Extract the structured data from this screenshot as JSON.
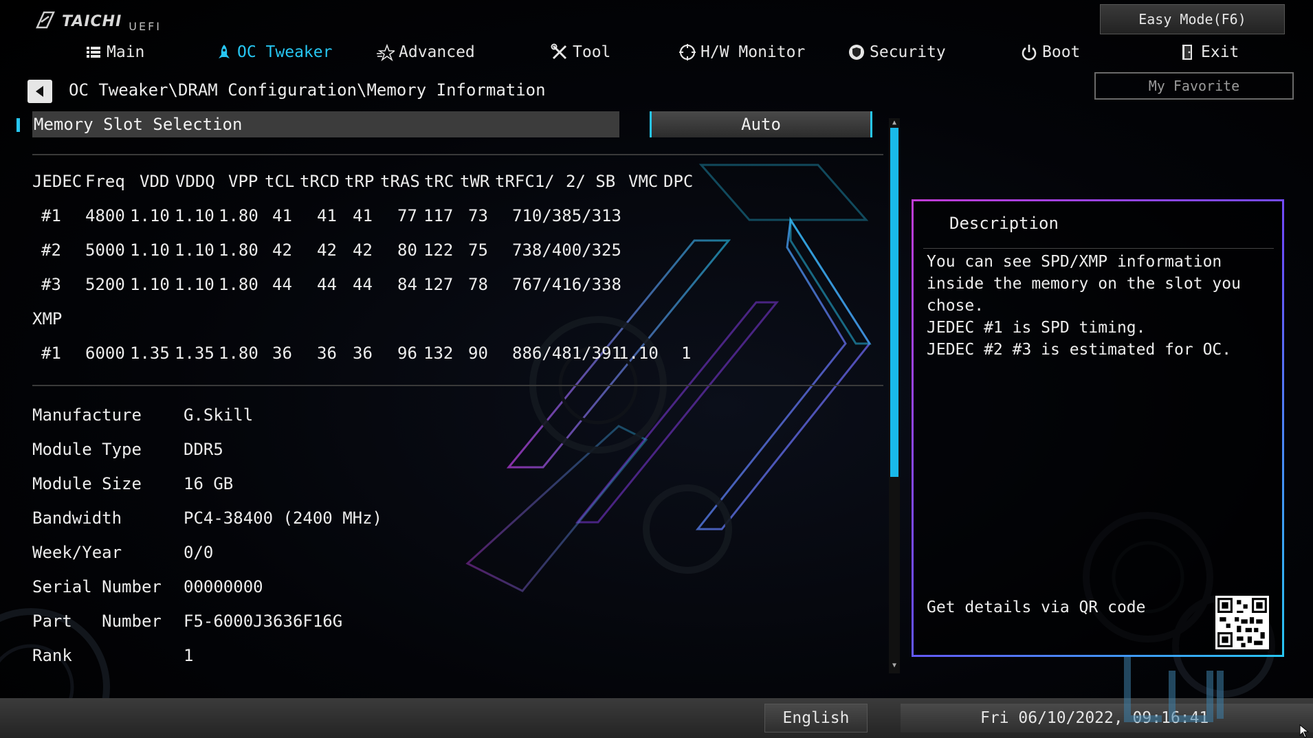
{
  "app": {
    "logo_text": "TAICHI",
    "logo_sub": "UEFI"
  },
  "nav": [
    {
      "label": "Main",
      "icon": "list-icon"
    },
    {
      "label": "OC Tweaker",
      "icon": "rocket-icon",
      "active": true
    },
    {
      "label": "Advanced",
      "icon": "star-icon"
    },
    {
      "label": "Tool",
      "icon": "tools-icon"
    },
    {
      "label": "H/W Monitor",
      "icon": "monitor-icon"
    },
    {
      "label": "Security",
      "icon": "shield-icon"
    },
    {
      "label": "Boot",
      "icon": "power-icon"
    },
    {
      "label": "Exit",
      "icon": "exit-door-icon"
    }
  ],
  "easy_mode_label": "Easy Mode(F6)",
  "my_favorite_label": "My Favorite",
  "breadcrumb": "OC Tweaker\\DRAM Configuration\\Memory Information",
  "slot_selection": {
    "label": "Memory Slot Selection",
    "value": "Auto"
  },
  "spd_table": {
    "headers": [
      "JEDEC",
      "Freq",
      "VDD",
      "VDDQ",
      "VPP",
      "tCL",
      "tRCD",
      "tRP",
      "tRAS",
      "tRC",
      "tWR",
      "tRFC1/",
      "2/ SB",
      "VMC",
      "DPC"
    ],
    "jedec_rows": [
      {
        "id": "#1",
        "freq": "4800",
        "vdd": "1.10",
        "vddq": "1.10",
        "vpp": "1.80",
        "tcl": "41",
        "trcd": "41",
        "trp": "41",
        "tras": "77",
        "trc": "117",
        "twr": "73",
        "trfc": "710/385/313"
      },
      {
        "id": "#2",
        "freq": "5000",
        "vdd": "1.10",
        "vddq": "1.10",
        "vpp": "1.80",
        "tcl": "42",
        "trcd": "42",
        "trp": "42",
        "tras": "80",
        "trc": "122",
        "twr": "75",
        "trfc": "738/400/325"
      },
      {
        "id": "#3",
        "freq": "5200",
        "vdd": "1.10",
        "vddq": "1.10",
        "vpp": "1.80",
        "tcl": "44",
        "trcd": "44",
        "trp": "44",
        "tras": "84",
        "trc": "127",
        "twr": "78",
        "trfc": "767/416/338"
      }
    ],
    "xmp_label": "XMP",
    "xmp_rows": [
      {
        "id": "#1",
        "freq": "6000",
        "vdd": "1.35",
        "vddq": "1.35",
        "vpp": "1.80",
        "tcl": "36",
        "trcd": "36",
        "trp": "36",
        "tras": "96",
        "trc": "132",
        "twr": "90",
        "trfc": "886/481/391",
        "vmc": "1.10",
        "dpc": "1"
      }
    ]
  },
  "module_info": [
    {
      "label": "Manufacture",
      "value": "G.Skill"
    },
    {
      "label": "Module Type",
      "value": "DDR5"
    },
    {
      "label": "Module Size",
      "value": "16 GB"
    },
    {
      "label": "Bandwidth",
      "value": "PC4-38400 (2400 MHz)"
    },
    {
      "label": "Week/Year",
      "value": "0/0"
    },
    {
      "label": "Serial Number",
      "value": "00000000"
    },
    {
      "label": "Part   Number",
      "value": "F5-6000J3636F16G"
    },
    {
      "label": "Rank",
      "value": "1"
    }
  ],
  "description": {
    "title": "Description",
    "text": "You can see SPD/XMP information\ninside the memory on the slot you\nchose.\nJEDEC #1 is SPD timing.\nJEDEC #2 #3 is estimated for OC.",
    "qr_label": "Get details via QR code"
  },
  "footer": {
    "language": "English",
    "datetime": "Fri 06/10/2022, 09:16:41"
  },
  "colors": {
    "accent": "#27c6f2",
    "panel_border_magenta": "#c03bd4",
    "scrollbar": "#19b9ea"
  }
}
